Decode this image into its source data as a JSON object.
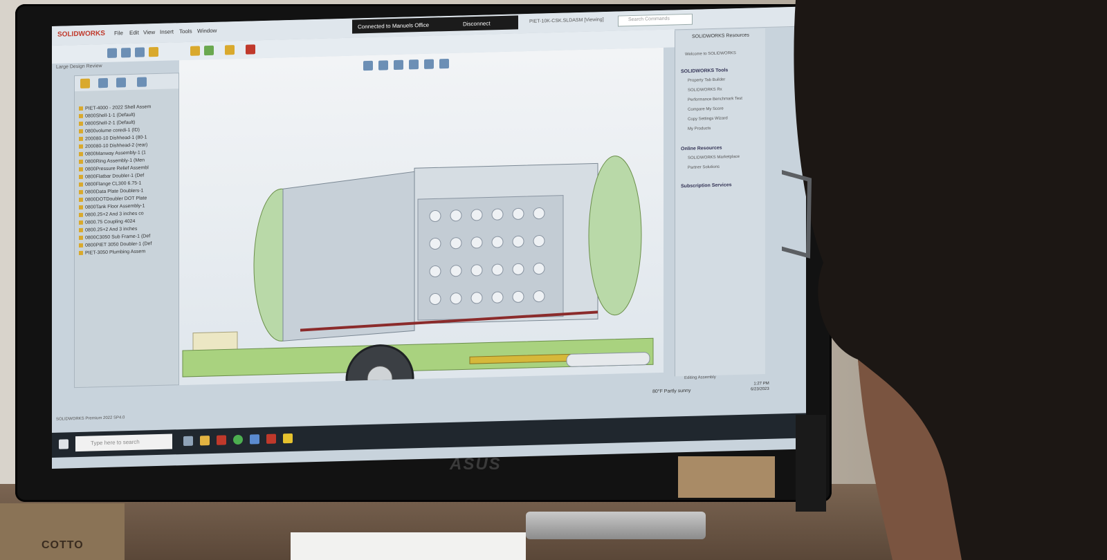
{
  "app": {
    "name": "SOLIDWORKS",
    "menus": [
      "File",
      "Edit",
      "View",
      "Insert",
      "Tools",
      "Window"
    ],
    "connection_banner": "Connected to Manuels Office",
    "disconnect_label": "Disconnect",
    "search_placeholder": "Search Commands",
    "document_title": "PIET-10K-CSK.SLDASM [Viewing]",
    "mode_label": "Large Design Review"
  },
  "tree": {
    "items": [
      "PIET-4000 - 2022 Shell Assem",
      "0800Shell-1-1 (Default)",
      "0800Shell-2-1 (Default)",
      "0800volume coredi-1 (ID)",
      "200080-10 Dishhead-1 (80-1",
      "200080-10 Dishhead-2 (rear)",
      "0800Manway Assembly-1 (1",
      "0800Ring Assembly-1 (Men",
      "0800Pressure Relief Assembl",
      "0800Flatbar Doubler-1 (Def",
      "0800Flange CL300 6.75-1",
      "0800Data Plate Doublers-1",
      "0800DOTDoubler DOT Plate",
      "0800Tank Floor Assembly-1",
      "0800.25+2 And 3 inches co",
      "0800.75 Coupling 4024",
      "0800.25+2 And 3 inches",
      "0800C3050 Sub Frame-1 (Def",
      "0800PIET 3050 Doubler-1 (Def",
      "PIET-3050 Plumbing Assem"
    ]
  },
  "resources": {
    "title": "SOLIDWORKS Resources",
    "welcome": "Welcome to SOLIDWORKS",
    "tools_header": "SOLIDWORKS Tools",
    "tools": [
      "Property Tab Builder",
      "SOLIDWORKS Rx",
      "Performance Benchmark Test",
      "Compare My Score",
      "Copy Settings Wizard",
      "My Products"
    ],
    "online_header": "Online Resources",
    "online": [
      "SOLIDWORKS Marketplace",
      "Partner Solutions"
    ],
    "subscription_header": "Subscription Services"
  },
  "status": {
    "product": "SOLIDWORKS Premium 2022 SP4.0",
    "editing": "Editing Assembly"
  },
  "taskbar": {
    "search_placeholder": "Type here to search",
    "weather": "80°F Partly sunny",
    "time": "1:27 PM",
    "date": "6/23/2023"
  },
  "monitor": {
    "brand": "ASUS"
  },
  "desk": {
    "frame_text": "COTTO"
  },
  "colors": {
    "tank_green": "#b9d9a8",
    "frame_green": "#9fd07a",
    "tank_body": "#c7d0d8",
    "accent_red": "#c0392b"
  }
}
